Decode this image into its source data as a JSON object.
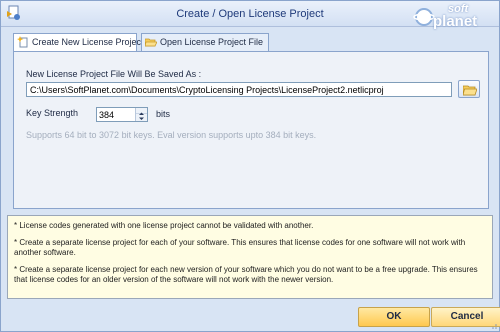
{
  "window": {
    "title": "Create / Open License Project",
    "logo_top": "soft",
    "logo_bottom": "planet"
  },
  "tabs": [
    {
      "label": "Create New License Project",
      "active": true,
      "icon": "new-star-icon"
    },
    {
      "label": "Open License Project File",
      "active": false,
      "icon": "folder-open-icon"
    }
  ],
  "form": {
    "file_label": "New License Project File Will Be Saved As :",
    "file_value": "C:\\Users\\SoftPlanet.com\\Documents\\CryptoLicensing Projects\\LicenseProject2.netlicproj",
    "browse_icon": "folder-open-icon",
    "key_label": "Key Strength",
    "key_value": "384",
    "bits_label": "bits",
    "hint": "Supports 64 bit to 3072 bit keys. Eval version supports upto 384 bit keys."
  },
  "info": [
    "* License codes generated with one license project cannot be validated with another.",
    "* Create a separate license project for each of your software. This ensures that license codes for one software will not work with another software.",
    "* Create a separate license project for each new version of your software which you do not want to be a free upgrade. This ensures that license codes for an older version of the software will not work with the newer version."
  ],
  "buttons": {
    "ok": "OK",
    "cancel": "Cancel"
  },
  "colors": {
    "accent": "#1f3a7a",
    "button_fill": "#ffc84f",
    "info_bg": "#fffde3"
  }
}
